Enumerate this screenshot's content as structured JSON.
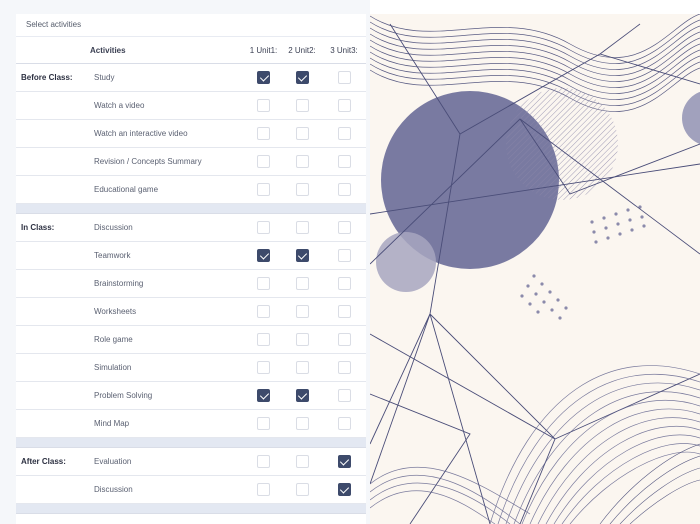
{
  "panel": {
    "title": "Select activities"
  },
  "table": {
    "headers": {
      "activities": "Activities",
      "unit1": "1 Unit1:",
      "unit2": "2 Unit2:",
      "unit3": "3 Unit3:"
    },
    "sections": [
      {
        "phase": "Before Class:",
        "rows": [
          {
            "label": "Study",
            "checks": [
              true,
              true,
              false
            ]
          },
          {
            "label": "Watch a video",
            "checks": [
              false,
              false,
              false
            ]
          },
          {
            "label": "Watch an interactive video",
            "checks": [
              false,
              false,
              false
            ]
          },
          {
            "label": "Revision / Concepts Summary",
            "checks": [
              false,
              false,
              false
            ]
          },
          {
            "label": "Educational game",
            "checks": [
              false,
              false,
              false
            ]
          }
        ]
      },
      {
        "phase": "In Class:",
        "rows": [
          {
            "label": "Discussion",
            "checks": [
              false,
              false,
              false
            ]
          },
          {
            "label": "Teamwork",
            "checks": [
              true,
              true,
              false
            ]
          },
          {
            "label": "Brainstorming",
            "checks": [
              false,
              false,
              false
            ]
          },
          {
            "label": "Worksheets",
            "checks": [
              false,
              false,
              false
            ]
          },
          {
            "label": "Role game",
            "checks": [
              false,
              false,
              false
            ]
          },
          {
            "label": "Simulation",
            "checks": [
              false,
              false,
              false
            ]
          },
          {
            "label": "Problem Solving",
            "checks": [
              true,
              true,
              false
            ]
          },
          {
            "label": "Mind Map",
            "checks": [
              false,
              false,
              false
            ]
          }
        ]
      },
      {
        "phase": "After Class:",
        "rows": [
          {
            "label": "Evaluation",
            "checks": [
              false,
              false,
              true
            ]
          },
          {
            "label": "Discussion",
            "checks": [
              false,
              false,
              true
            ]
          }
        ]
      }
    ]
  },
  "colors": {
    "checkbox_checked": "#3d4a6b",
    "section_separator": "#e3e8f2",
    "art_background": "#fbf6f0",
    "art_circle": "#6e6f9a"
  }
}
